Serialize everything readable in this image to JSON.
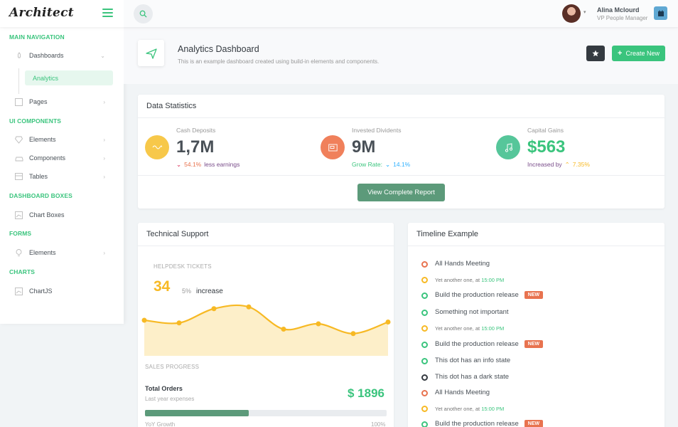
{
  "header": {
    "logo": "Architect",
    "user_name": "Alina Mclourd",
    "user_role": "VP People Manager"
  },
  "sidebar": {
    "heading_main": "MAIN NAVIGATION",
    "dashboards": "Dashboards",
    "analytics": "Analytics",
    "pages": "Pages",
    "heading_ui": "UI COMPONENTS",
    "elements": "Elements",
    "components": "Components",
    "tables": "Tables",
    "heading_boxes": "DASHBOARD BOXES",
    "chart_boxes": "Chart Boxes",
    "heading_forms": "FORMS",
    "form_elements": "Elements",
    "heading_charts": "CHARTS",
    "chartjs": "ChartJS"
  },
  "page": {
    "title": "Analytics Dashboard",
    "subtitle": "This is an example dashboard created using build-in elements and components.",
    "create_label": "Create New"
  },
  "stats": {
    "header": "Data Statistics",
    "cash_label": "Cash Deposits",
    "cash_value": "1,7M",
    "cash_pct": "54.1%",
    "cash_note": "less earnings",
    "invest_label": "Invested Dividents",
    "invest_value": "9M",
    "invest_note": "Grow Rate:",
    "invest_pct": "14.1%",
    "gains_label": "Capital Gains",
    "gains_value": "$563",
    "gains_note": "Increased by",
    "gains_pct": "7.35%",
    "report_label": "View Complete Report"
  },
  "support": {
    "header": "Technical Support",
    "helpdesk_label": "HELPDESK TICKETS",
    "tickets": "34",
    "pct": "5%",
    "pct_word": "increase",
    "sales_label": "SALES PROGRESS",
    "orders_label": "Total Orders",
    "orders_sub": "Last year expenses",
    "orders_value": "$ 1896",
    "progress": 0.43,
    "yoy_label": "YoY Growth",
    "yoy_value": "100%"
  },
  "chart_data": {
    "type": "area",
    "values": [
      40,
      37,
      53,
      55,
      30,
      36,
      25,
      38
    ],
    "ylim": [
      0,
      80
    ],
    "color": "#f7b924"
  },
  "timeline": {
    "header": "Timeline Example",
    "items": [
      {
        "text": "All Hands Meeting",
        "color": "#e8734f"
      },
      {
        "sub": "Yet another one, at ",
        "time": "15:00 PM",
        "color": "#f7b924"
      },
      {
        "text": "Build the production release",
        "badge": "NEW",
        "color": "#3ac47d"
      },
      {
        "text": "Something not important",
        "color": "#3ac47d"
      },
      {
        "sub": "Yet another one, at ",
        "time": "15:00 PM",
        "color": "#f7b924"
      },
      {
        "text": "Build the production release",
        "badge": "NEW",
        "color": "#3ac47d"
      },
      {
        "text": "This dot has an info state",
        "color": "#3ac47d"
      },
      {
        "text": "This dot has a dark state",
        "color": "#343a40"
      },
      {
        "text": "All Hands Meeting",
        "color": "#e8734f"
      },
      {
        "sub": "Yet another one, at ",
        "time": "15:00 PM",
        "color": "#f7b924"
      },
      {
        "text": "Build the production release",
        "badge": "NEW",
        "color": "#3ac47d"
      }
    ]
  }
}
